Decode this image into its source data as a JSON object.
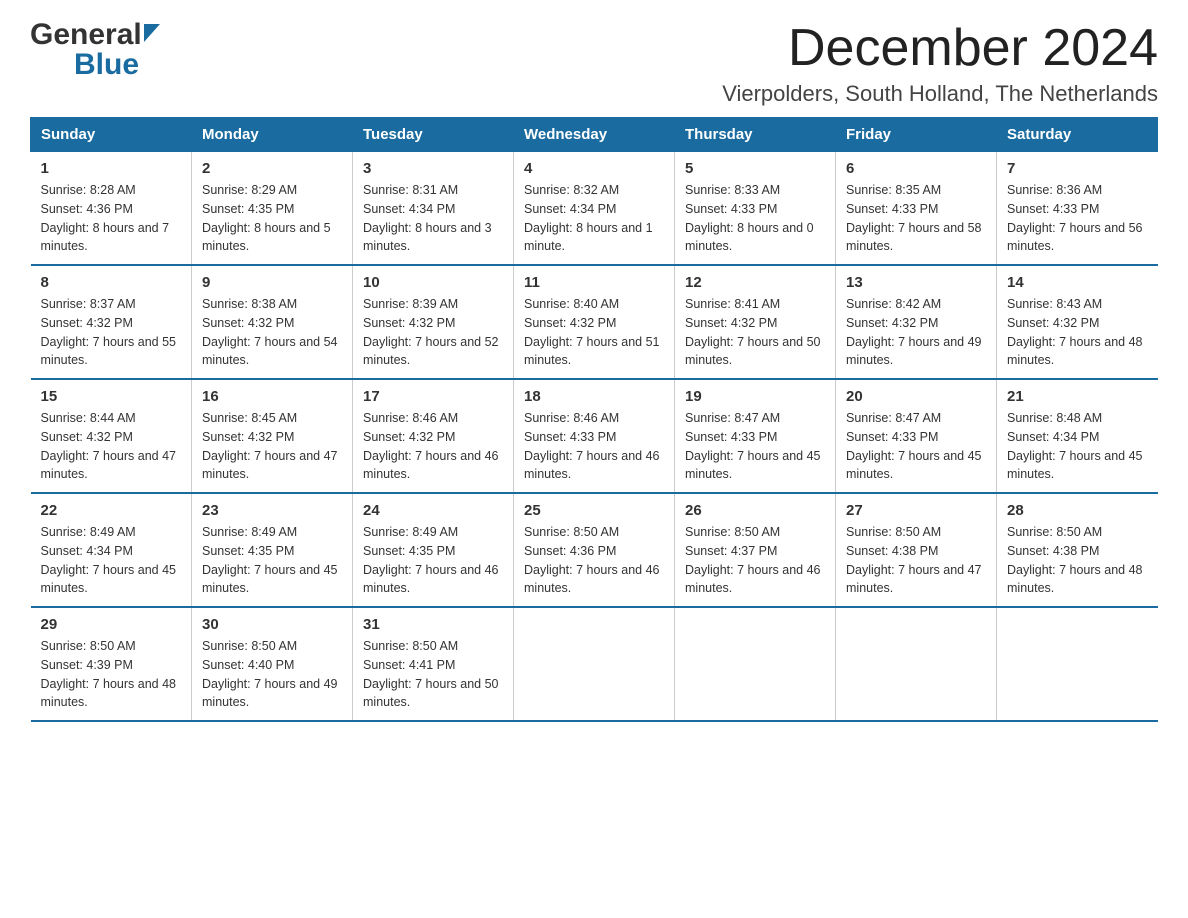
{
  "logo": {
    "general": "General",
    "blue": "Blue"
  },
  "title": "December 2024",
  "subtitle": "Vierpolders, South Holland, The Netherlands",
  "days_of_week": [
    "Sunday",
    "Monday",
    "Tuesday",
    "Wednesday",
    "Thursday",
    "Friday",
    "Saturday"
  ],
  "weeks": [
    [
      {
        "day": "1",
        "sunrise": "8:28 AM",
        "sunset": "4:36 PM",
        "daylight": "8 hours and 7 minutes."
      },
      {
        "day": "2",
        "sunrise": "8:29 AM",
        "sunset": "4:35 PM",
        "daylight": "8 hours and 5 minutes."
      },
      {
        "day": "3",
        "sunrise": "8:31 AM",
        "sunset": "4:34 PM",
        "daylight": "8 hours and 3 minutes."
      },
      {
        "day": "4",
        "sunrise": "8:32 AM",
        "sunset": "4:34 PM",
        "daylight": "8 hours and 1 minute."
      },
      {
        "day": "5",
        "sunrise": "8:33 AM",
        "sunset": "4:33 PM",
        "daylight": "8 hours and 0 minutes."
      },
      {
        "day": "6",
        "sunrise": "8:35 AM",
        "sunset": "4:33 PM",
        "daylight": "7 hours and 58 minutes."
      },
      {
        "day": "7",
        "sunrise": "8:36 AM",
        "sunset": "4:33 PM",
        "daylight": "7 hours and 56 minutes."
      }
    ],
    [
      {
        "day": "8",
        "sunrise": "8:37 AM",
        "sunset": "4:32 PM",
        "daylight": "7 hours and 55 minutes."
      },
      {
        "day": "9",
        "sunrise": "8:38 AM",
        "sunset": "4:32 PM",
        "daylight": "7 hours and 54 minutes."
      },
      {
        "day": "10",
        "sunrise": "8:39 AM",
        "sunset": "4:32 PM",
        "daylight": "7 hours and 52 minutes."
      },
      {
        "day": "11",
        "sunrise": "8:40 AM",
        "sunset": "4:32 PM",
        "daylight": "7 hours and 51 minutes."
      },
      {
        "day": "12",
        "sunrise": "8:41 AM",
        "sunset": "4:32 PM",
        "daylight": "7 hours and 50 minutes."
      },
      {
        "day": "13",
        "sunrise": "8:42 AM",
        "sunset": "4:32 PM",
        "daylight": "7 hours and 49 minutes."
      },
      {
        "day": "14",
        "sunrise": "8:43 AM",
        "sunset": "4:32 PM",
        "daylight": "7 hours and 48 minutes."
      }
    ],
    [
      {
        "day": "15",
        "sunrise": "8:44 AM",
        "sunset": "4:32 PM",
        "daylight": "7 hours and 47 minutes."
      },
      {
        "day": "16",
        "sunrise": "8:45 AM",
        "sunset": "4:32 PM",
        "daylight": "7 hours and 47 minutes."
      },
      {
        "day": "17",
        "sunrise": "8:46 AM",
        "sunset": "4:32 PM",
        "daylight": "7 hours and 46 minutes."
      },
      {
        "day": "18",
        "sunrise": "8:46 AM",
        "sunset": "4:33 PM",
        "daylight": "7 hours and 46 minutes."
      },
      {
        "day": "19",
        "sunrise": "8:47 AM",
        "sunset": "4:33 PM",
        "daylight": "7 hours and 45 minutes."
      },
      {
        "day": "20",
        "sunrise": "8:47 AM",
        "sunset": "4:33 PM",
        "daylight": "7 hours and 45 minutes."
      },
      {
        "day": "21",
        "sunrise": "8:48 AM",
        "sunset": "4:34 PM",
        "daylight": "7 hours and 45 minutes."
      }
    ],
    [
      {
        "day": "22",
        "sunrise": "8:49 AM",
        "sunset": "4:34 PM",
        "daylight": "7 hours and 45 minutes."
      },
      {
        "day": "23",
        "sunrise": "8:49 AM",
        "sunset": "4:35 PM",
        "daylight": "7 hours and 45 minutes."
      },
      {
        "day": "24",
        "sunrise": "8:49 AM",
        "sunset": "4:35 PM",
        "daylight": "7 hours and 46 minutes."
      },
      {
        "day": "25",
        "sunrise": "8:50 AM",
        "sunset": "4:36 PM",
        "daylight": "7 hours and 46 minutes."
      },
      {
        "day": "26",
        "sunrise": "8:50 AM",
        "sunset": "4:37 PM",
        "daylight": "7 hours and 46 minutes."
      },
      {
        "day": "27",
        "sunrise": "8:50 AM",
        "sunset": "4:38 PM",
        "daylight": "7 hours and 47 minutes."
      },
      {
        "day": "28",
        "sunrise": "8:50 AM",
        "sunset": "4:38 PM",
        "daylight": "7 hours and 48 minutes."
      }
    ],
    [
      {
        "day": "29",
        "sunrise": "8:50 AM",
        "sunset": "4:39 PM",
        "daylight": "7 hours and 48 minutes."
      },
      {
        "day": "30",
        "sunrise": "8:50 AM",
        "sunset": "4:40 PM",
        "daylight": "7 hours and 49 minutes."
      },
      {
        "day": "31",
        "sunrise": "8:50 AM",
        "sunset": "4:41 PM",
        "daylight": "7 hours and 50 minutes."
      },
      null,
      null,
      null,
      null
    ]
  ]
}
